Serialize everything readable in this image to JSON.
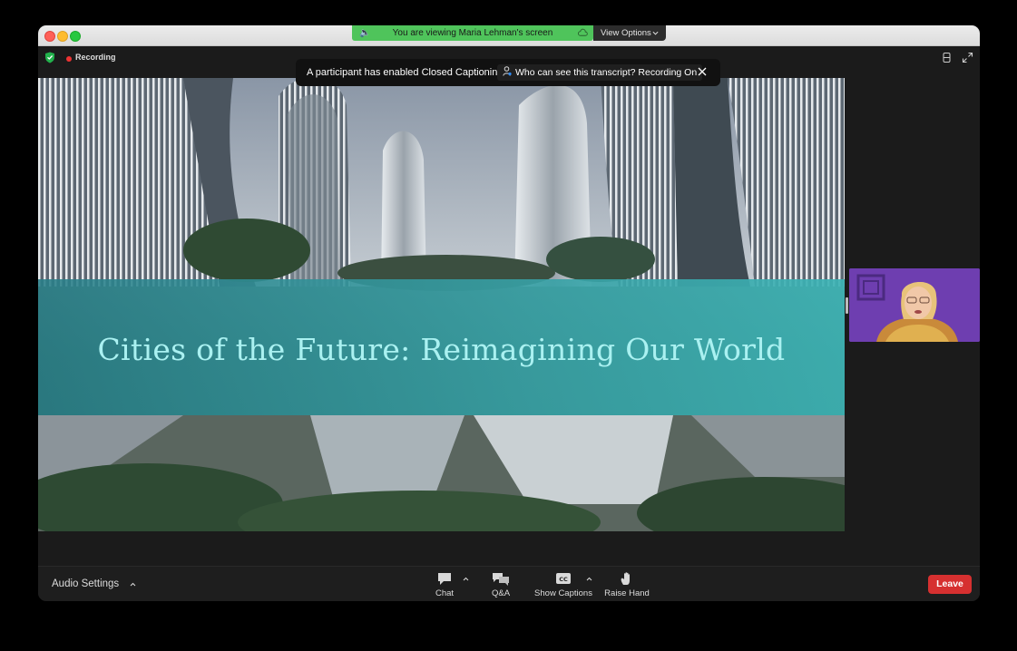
{
  "share_banner": {
    "text": "You are viewing Maria Lehman's screen",
    "view_options_label": "View Options"
  },
  "status": {
    "recording_label": "Recording"
  },
  "cc_notice": {
    "message": "A participant has enabled Closed Captioning",
    "who_button": "Who can see this transcript? Recording On"
  },
  "slide": {
    "title": "Cities of the Future: Reimagining Our World"
  },
  "participant_video": {
    "name": ""
  },
  "toolbar": {
    "audio_settings": "Audio Settings",
    "chat": "Chat",
    "qa": "Q&A",
    "show_captions": "Show Captions",
    "raise_hand": "Raise Hand",
    "leave": "Leave"
  },
  "colors": {
    "share_banner": "#4fc45b",
    "leave_button": "#d63030",
    "title_band": "#37a0a5",
    "participant_bg": "#6f3fb2"
  }
}
